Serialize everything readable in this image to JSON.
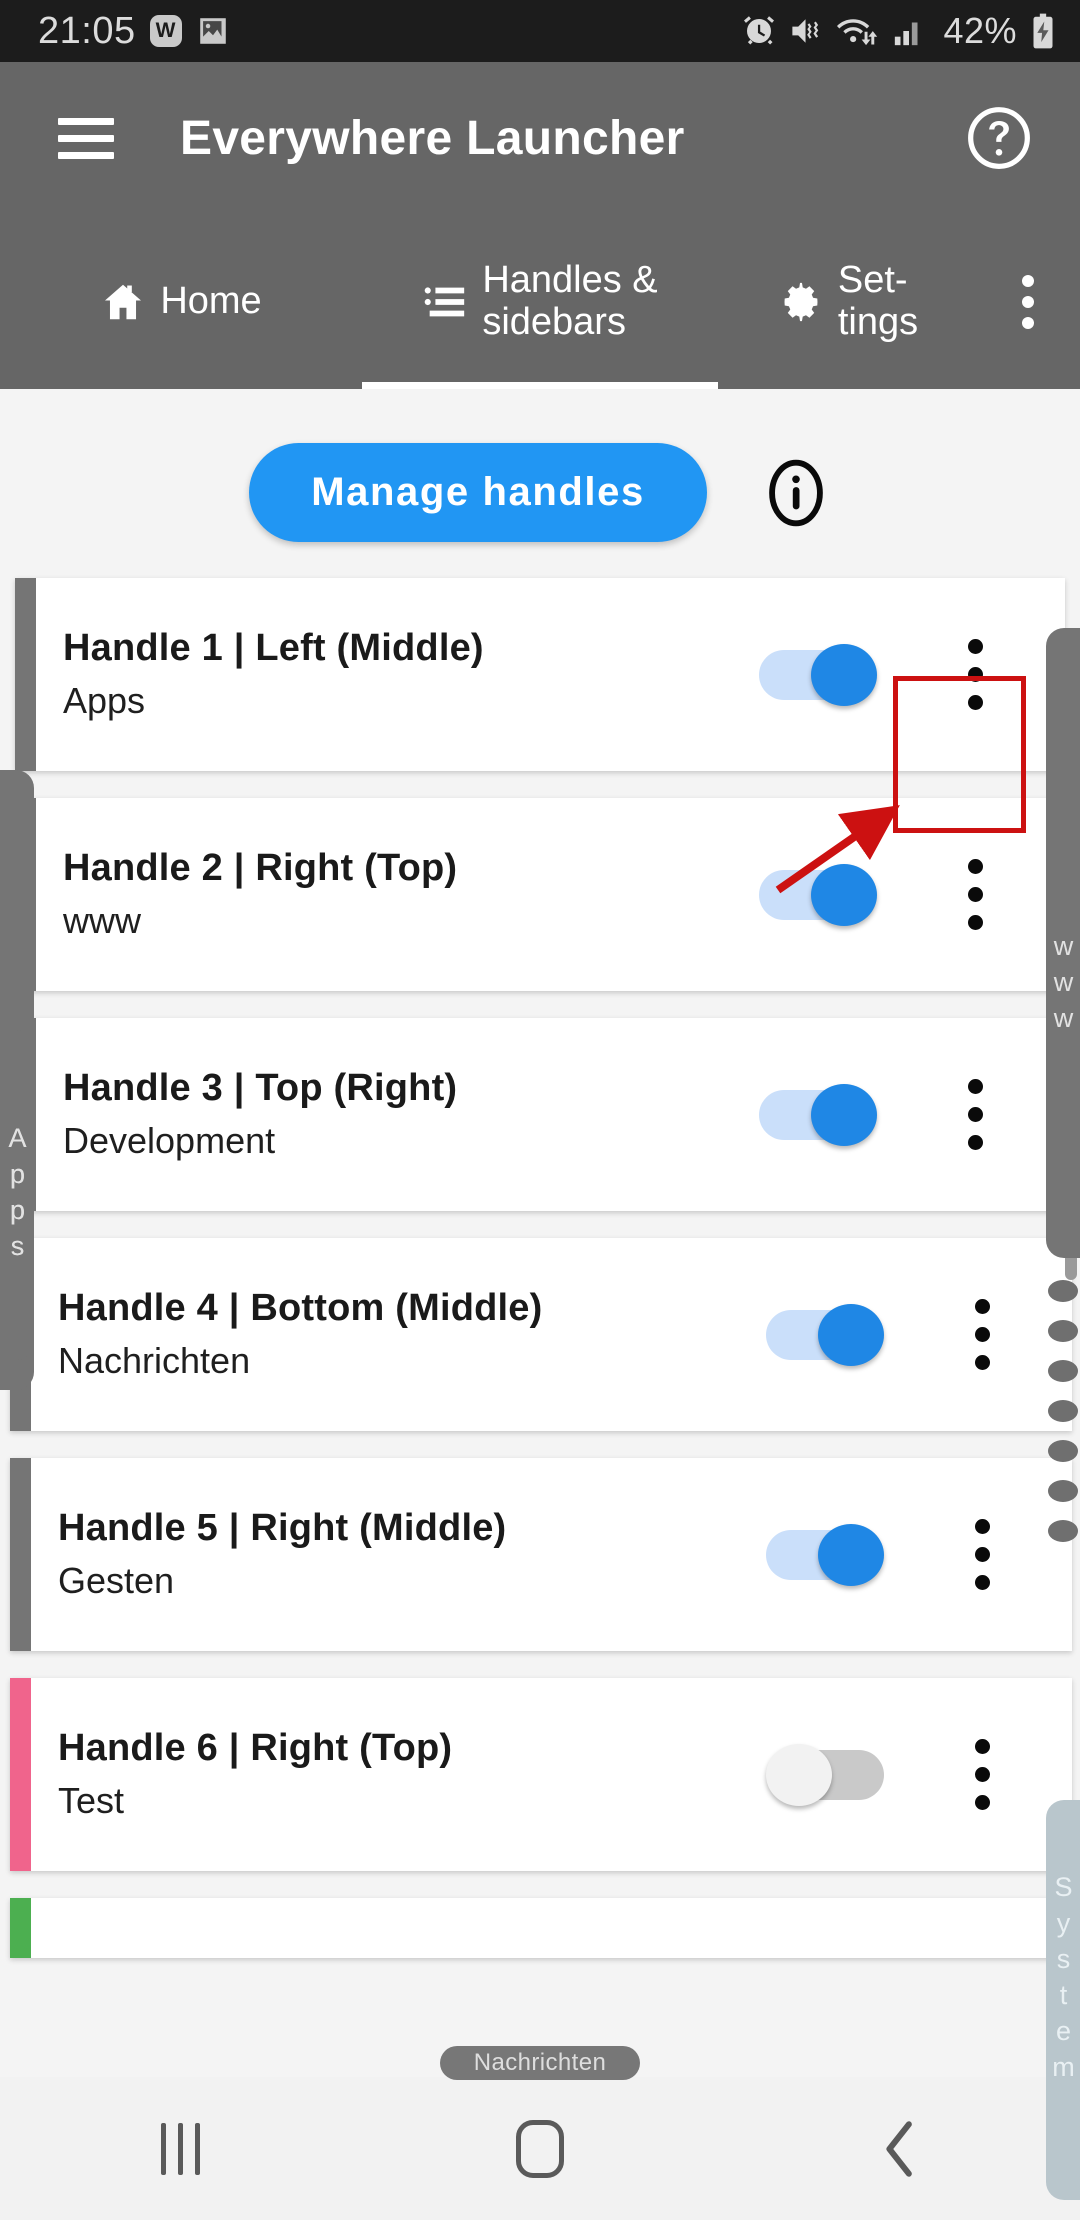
{
  "status_bar": {
    "time": "21:05",
    "battery_percent": "42%",
    "icons": [
      "w-app-badge",
      "image-icon",
      "alarm-icon",
      "mute-vibrate-icon",
      "wifi-transfer-icon",
      "signal-bars-icon",
      "battery-charging-icon"
    ]
  },
  "app_bar": {
    "title": "Everywhere Launcher",
    "menu_icon": "hamburger-icon",
    "help_icon": "help-circle-icon"
  },
  "tabs": [
    {
      "label": "Home",
      "icon": "home-icon",
      "active": false
    },
    {
      "label": "Handles & sidebars",
      "label_line1": "Handles &",
      "label_line2": "sidebars",
      "icon": "list-icon",
      "active": true
    },
    {
      "label": "Set-tings",
      "label_line1": "Set-",
      "label_line2": "tings",
      "icon": "gear-icon",
      "active": false
    }
  ],
  "overflow_menu_icon": "more-vert-icon",
  "toolbar": {
    "manage_handles_label": "Manage handles",
    "info_icon": "info-circle-icon",
    "accent_color": "#2196f3"
  },
  "handles": [
    {
      "title": "Handle 1 | Left (Middle)",
      "subtitle": "Apps",
      "enabled": true,
      "accent": "#757575"
    },
    {
      "title": "Handle 2 | Right (Top)",
      "subtitle": "www",
      "enabled": true,
      "accent": "#757575"
    },
    {
      "title": "Handle 3 | Top (Right)",
      "subtitle": "Development",
      "enabled": true,
      "accent": "#757575"
    },
    {
      "title": "Handle 4 | Bottom (Middle)",
      "subtitle": "Nachrichten",
      "enabled": true,
      "accent": "#757575"
    },
    {
      "title": "Handle 5 | Right (Middle)",
      "subtitle": "Gesten",
      "enabled": true,
      "accent": "#757575"
    },
    {
      "title": "Handle 6 | Right (Top)",
      "subtitle": "Test",
      "enabled": false,
      "accent": "#f0648c"
    },
    {
      "title": "",
      "subtitle": "",
      "enabled": true,
      "accent": "#4caf50"
    }
  ],
  "overlay_handles": {
    "left_label": "Apps",
    "right_label": "www",
    "system_label": "System",
    "bottom_label": "Nachrichten"
  },
  "annotation": {
    "highlight_color": "#cc1111",
    "target": "handle-1-overflow-menu"
  },
  "nav_bar": {
    "recents_icon": "recents-icon",
    "home_icon": "home-square-icon",
    "back_icon": "back-chevron-icon"
  }
}
